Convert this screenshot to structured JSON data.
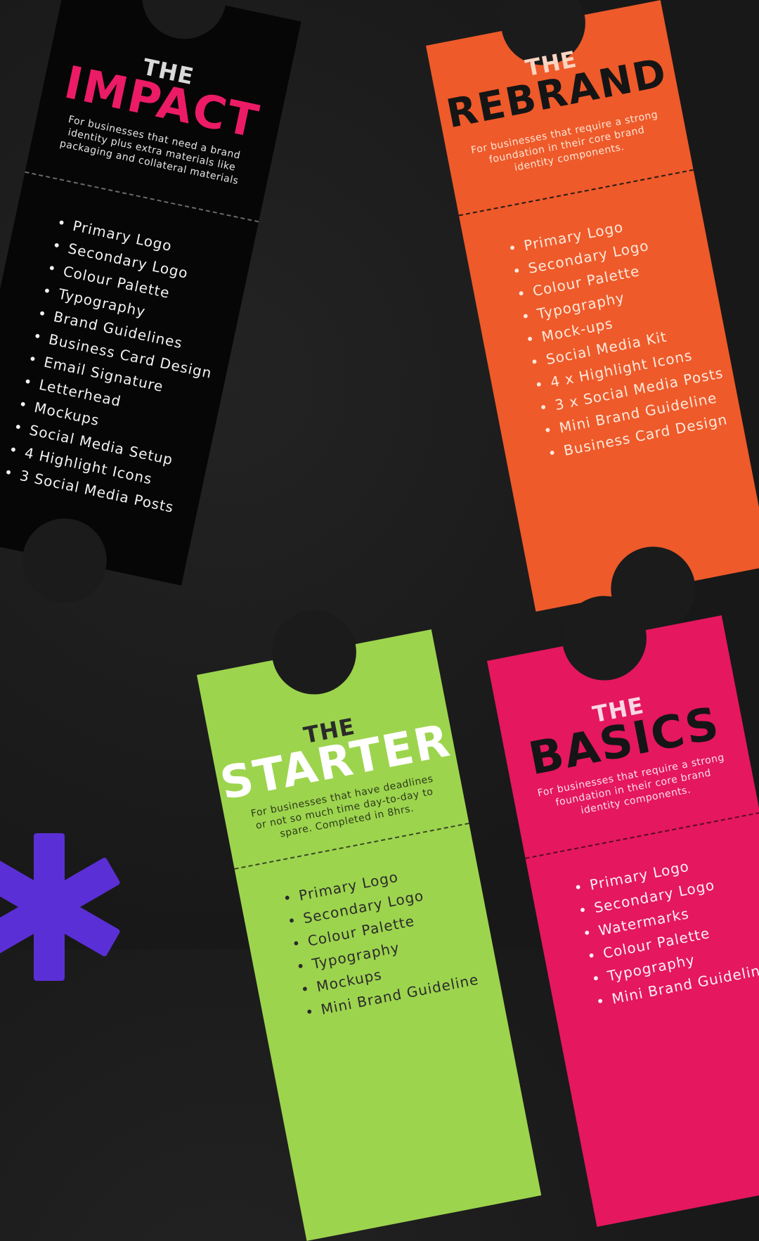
{
  "tickets": {
    "impact": {
      "the": "THE",
      "name": "IMPACT",
      "description": "For businesses that need a brand identity plus extra materials like packaging and collateral materials",
      "items": [
        "Primary Logo",
        "Secondary Logo",
        "Colour Palette",
        "Typography",
        "Brand Guidelines",
        "Business Card Design",
        "Email Signature",
        "Letterhead",
        "Mockups",
        "Social Media Setup",
        "4 Highlight Icons",
        "3 Social Media Posts"
      ],
      "color": "#060606",
      "accent": "#ec1b66"
    },
    "rebrand": {
      "the": "THE",
      "name": "REBRAND",
      "description": "For businesses that require a strong foundation in their core brand identity components.",
      "items": [
        "Primary Logo",
        "Secondary Logo",
        "Colour Palette",
        "Typography",
        "Mock-ups",
        "Social Media Kit",
        "4 x Highlight Icons",
        "3 x Social Media Posts",
        "Mini Brand Guideline",
        "Business Card Design"
      ],
      "color": "#ee5a2a"
    },
    "starter": {
      "the": "THE",
      "name": "STARTER",
      "description": "For businesses that have deadlines or not so much time day-to-day to spare. Completed in 8hrs.",
      "items": [
        "Primary Logo",
        "Secondary Logo",
        "Colour Palette",
        "Typography",
        "Mockups",
        "Mini Brand Guideline"
      ],
      "color": "#9dd44e"
    },
    "basics": {
      "the": "THE",
      "name": "BASICS",
      "description": "For businesses that require a strong foundation in their core brand identity components.",
      "items": [
        "Primary Logo",
        "Secondary Logo",
        "Watermarks",
        "Colour Palette",
        "Typography",
        "Mini Brand Guideline"
      ],
      "color": "#e4175f"
    }
  },
  "decor": {
    "asterisk_color": "#5b2fd6",
    "icon": "asterisk-shape"
  }
}
